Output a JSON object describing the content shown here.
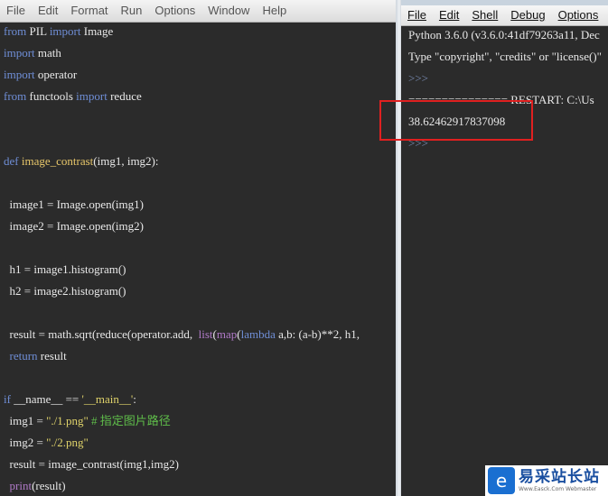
{
  "editor": {
    "menu": [
      "File",
      "Edit",
      "Format",
      "Run",
      "Options",
      "Window",
      "Help"
    ],
    "lines": [
      {
        "parts": [
          {
            "t": "from",
            "c": "kw"
          },
          {
            "t": " PIL ",
            "c": ""
          },
          {
            "t": "import",
            "c": "kw"
          },
          {
            "t": " Image",
            "c": ""
          }
        ]
      },
      {
        "parts": [
          {
            "t": "import",
            "c": "kw"
          },
          {
            "t": " math",
            "c": ""
          }
        ]
      },
      {
        "parts": [
          {
            "t": "import",
            "c": "kw"
          },
          {
            "t": " operator",
            "c": ""
          }
        ]
      },
      {
        "parts": [
          {
            "t": "from",
            "c": "kw"
          },
          {
            "t": " functools ",
            "c": ""
          },
          {
            "t": "import",
            "c": "kw"
          },
          {
            "t": " reduce",
            "c": ""
          }
        ]
      },
      {
        "parts": []
      },
      {
        "parts": []
      },
      {
        "parts": [
          {
            "t": "def",
            "c": "kw"
          },
          {
            "t": " ",
            "c": ""
          },
          {
            "t": "image_contrast",
            "c": "fn"
          },
          {
            "t": "(img1, img2):",
            "c": ""
          }
        ]
      },
      {
        "parts": []
      },
      {
        "parts": [
          {
            "t": "  image1 = Image.open(img1)",
            "c": ""
          }
        ]
      },
      {
        "parts": [
          {
            "t": "  image2 = Image.open(img2)",
            "c": ""
          }
        ]
      },
      {
        "parts": []
      },
      {
        "parts": [
          {
            "t": "  h1 = image1.histogram()",
            "c": ""
          }
        ]
      },
      {
        "parts": [
          {
            "t": "  h2 = image2.histogram()",
            "c": ""
          }
        ]
      },
      {
        "parts": []
      },
      {
        "parts": [
          {
            "t": "  result = math.sqrt(reduce(operator.add,  ",
            "c": ""
          },
          {
            "t": "list",
            "c": "bi"
          },
          {
            "t": "(",
            "c": ""
          },
          {
            "t": "map",
            "c": "bi"
          },
          {
            "t": "(",
            "c": ""
          },
          {
            "t": "lambda",
            "c": "kw"
          },
          {
            "t": " a,b: (a-b)**2, h1,",
            "c": ""
          }
        ]
      },
      {
        "parts": [
          {
            "t": "  ",
            "c": ""
          },
          {
            "t": "return",
            "c": "kw"
          },
          {
            "t": " result",
            "c": ""
          }
        ]
      },
      {
        "parts": []
      },
      {
        "parts": [
          {
            "t": "if",
            "c": "kw"
          },
          {
            "t": " __name__ == ",
            "c": ""
          },
          {
            "t": "'__main__'",
            "c": "str"
          },
          {
            "t": ":",
            "c": ""
          }
        ]
      },
      {
        "parts": [
          {
            "t": "  img1 = ",
            "c": ""
          },
          {
            "t": "\"./1.png\"",
            "c": "str"
          },
          {
            "t": " ",
            "c": ""
          },
          {
            "t": "# 指定图片路径",
            "c": "cm"
          }
        ]
      },
      {
        "parts": [
          {
            "t": "  img2 = ",
            "c": ""
          },
          {
            "t": "\"./2.png\"",
            "c": "str"
          }
        ]
      },
      {
        "parts": [
          {
            "t": "  result = image_contrast(img1,img2)",
            "c": ""
          }
        ]
      },
      {
        "parts": [
          {
            "t": "  ",
            "c": ""
          },
          {
            "t": "print",
            "c": "bi"
          },
          {
            "t": "(result)",
            "c": ""
          }
        ]
      }
    ]
  },
  "shell": {
    "menu": [
      "File",
      "Edit",
      "Shell",
      "Debug",
      "Options"
    ],
    "lines": [
      {
        "text": "Python 3.6.0 (v3.6.0:41df79263a11, Dec",
        "c": ""
      },
      {
        "text": "Type \"copyright\", \"credits\" or \"license()\"",
        "c": ""
      },
      {
        "text": ">>>",
        "c": "prompt"
      },
      {
        "text": "=============== RESTART: C:\\Us",
        "c": ""
      },
      {
        "text": "38.62462917837098",
        "c": ""
      },
      {
        "text": ">>>",
        "c": "prompt"
      }
    ]
  },
  "watermark": {
    "logo": "e",
    "main": "易采站长站",
    "sub": "Www.Easck.Com Webmaster"
  }
}
